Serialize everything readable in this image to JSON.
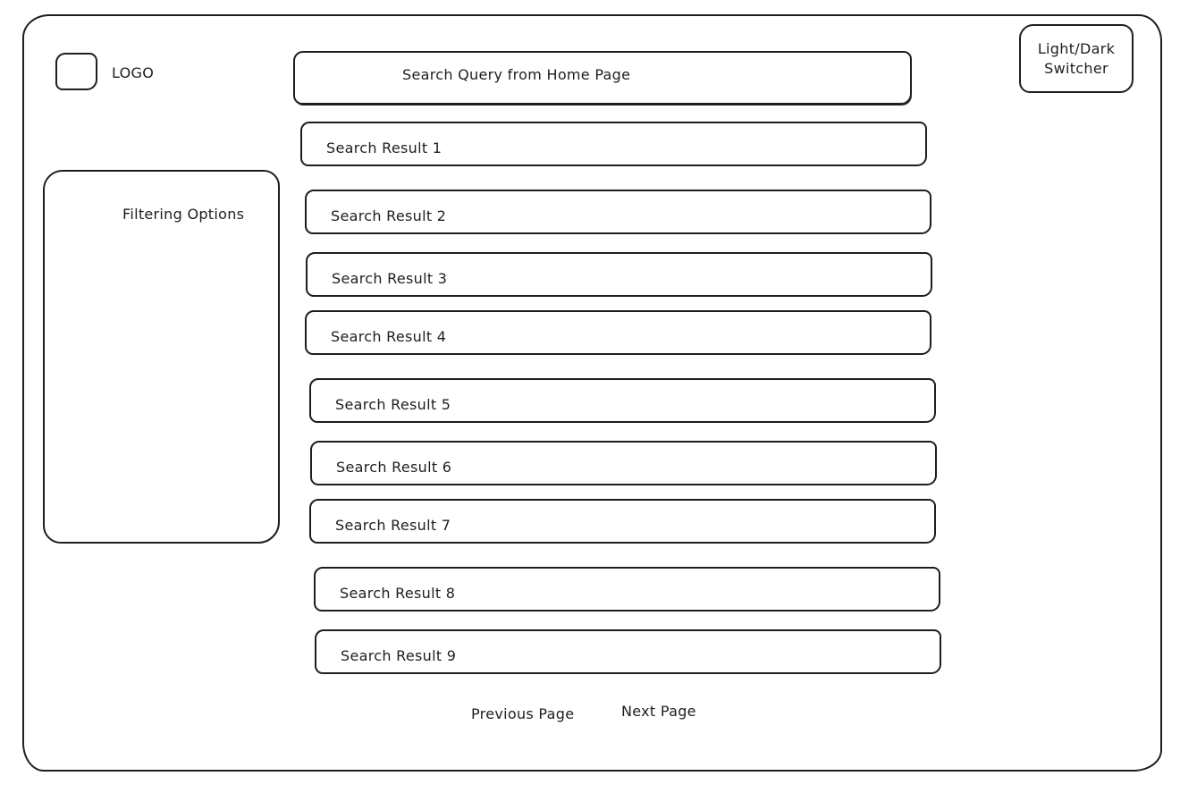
{
  "header": {
    "logo_label": "LOGO",
    "search_query": "Search Query from Home Page",
    "theme_switcher_label": "Light/Dark\nSwitcher"
  },
  "sidebar": {
    "title": "Filtering Options"
  },
  "results": [
    "Search Result 1",
    "Search Result 2",
    "Search Result 3",
    "Search Result 4",
    "Search Result 5",
    "Search Result 6",
    "Search Result 7",
    "Search Result 8",
    "Search Result 9"
  ],
  "pagination": {
    "previous_label": "Previous Page",
    "next_label": "Next Page"
  }
}
